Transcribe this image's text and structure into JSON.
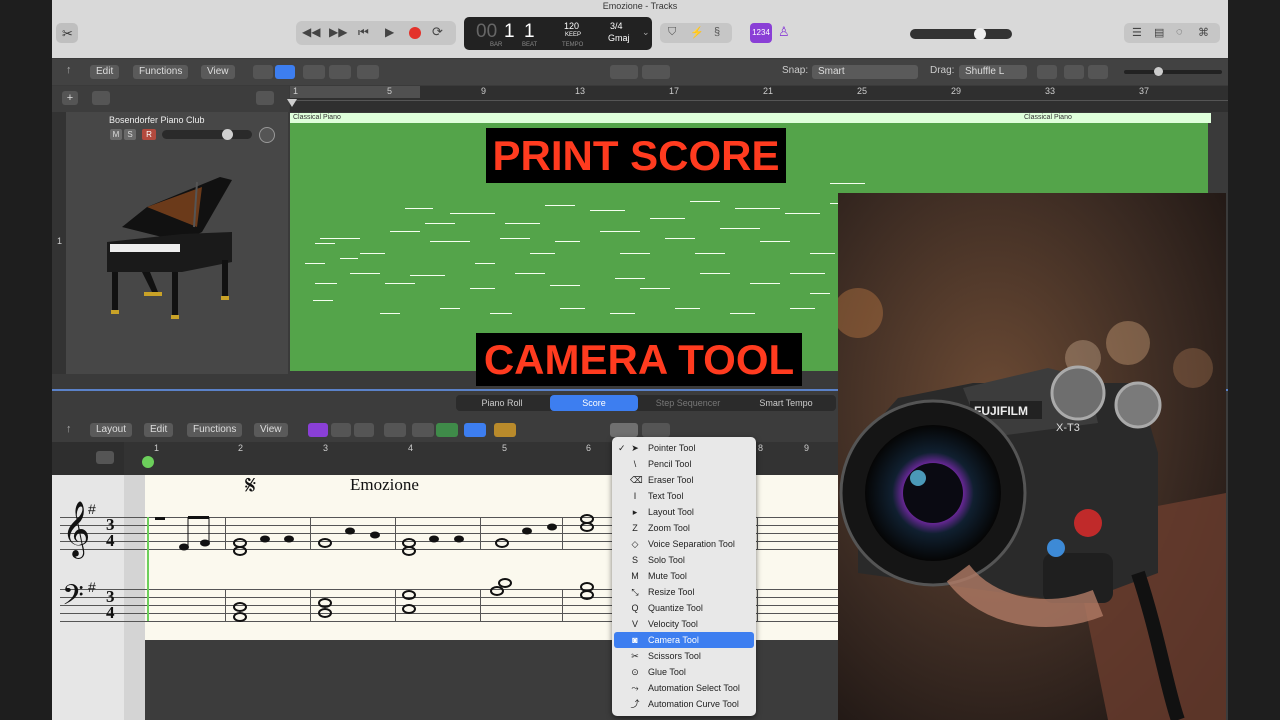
{
  "window": {
    "title": "Emozione - Tracks"
  },
  "lcd": {
    "bar": "1",
    "beat": "1",
    "bar_label": "BAR",
    "beat_label": "BEAT",
    "bar_prefix": "00",
    "tempo": "120",
    "tempo_mode": "KEEP",
    "tempo_label": "TEMPO",
    "signature": "3/4",
    "key": "Gmaj"
  },
  "lcd_badge": "1234",
  "tracks_toolbar": {
    "edit": "Edit",
    "functions": "Functions",
    "view": "View",
    "snap_label": "Snap:",
    "snap_value": "Smart",
    "drag_label": "Drag:",
    "drag_value": "Shuffle L"
  },
  "ruler": [
    "1",
    "5",
    "9",
    "13",
    "17",
    "21",
    "25",
    "29",
    "33",
    "37"
  ],
  "track": {
    "number": "1",
    "name": "Bosendorfer Piano Club",
    "mute": "M",
    "solo": "S",
    "record": "R"
  },
  "region": {
    "name_left": "Classical Piano",
    "name_right": "Classical Piano"
  },
  "overlays": {
    "top": "PRINT SCORE",
    "bottom": "CAMERA TOOL"
  },
  "editor_tabs": [
    "Piano Roll",
    "Score",
    "Step Sequencer",
    "Smart Tempo"
  ],
  "editor_toolbar": {
    "layout": "Layout",
    "edit": "Edit",
    "functions": "Functions",
    "view": "View"
  },
  "score_ruler": [
    "1",
    "2",
    "3",
    "4",
    "5",
    "6",
    "8",
    "9"
  ],
  "score": {
    "title": "Emozione",
    "time_sig_top": "3",
    "time_sig_bottom": "4"
  },
  "tool_menu": [
    {
      "key": "",
      "label": "Pointer Tool",
      "icon": "arrow-pointer-icon",
      "checked": true
    },
    {
      "key": "",
      "label": "Pencil Tool",
      "icon": "pencil-icon"
    },
    {
      "key": "",
      "label": "Eraser Tool",
      "icon": "eraser-icon"
    },
    {
      "key": "",
      "label": "Text Tool",
      "icon": "text-cursor-icon"
    },
    {
      "key": "",
      "label": "Layout Tool",
      "icon": "layout-icon"
    },
    {
      "key": "Z",
      "label": "Zoom Tool",
      "icon": "magnifier-icon"
    },
    {
      "key": "",
      "label": "Voice Separation Tool",
      "icon": "voice-separation-icon"
    },
    {
      "key": "S",
      "label": "Solo Tool",
      "icon": "solo-icon"
    },
    {
      "key": "M",
      "label": "Mute Tool",
      "icon": "mute-icon"
    },
    {
      "key": "",
      "label": "Resize Tool",
      "icon": "resize-icon"
    },
    {
      "key": "Q",
      "label": "Quantize Tool",
      "icon": "quantize-icon"
    },
    {
      "key": "V",
      "label": "Velocity Tool",
      "icon": "velocity-icon"
    },
    {
      "key": "",
      "label": "Camera Tool",
      "icon": "camera-icon",
      "selected": true
    },
    {
      "key": "",
      "label": "Scissors Tool",
      "icon": "scissors-icon"
    },
    {
      "key": "",
      "label": "Glue Tool",
      "icon": "glue-icon"
    },
    {
      "key": "",
      "label": "Automation Select Tool",
      "icon": "automation-select-icon"
    },
    {
      "key": "",
      "label": "Automation Curve Tool",
      "icon": "automation-curve-icon"
    }
  ],
  "camera_photo": {
    "brand": "FUJIFILM",
    "model": "X-T3"
  }
}
